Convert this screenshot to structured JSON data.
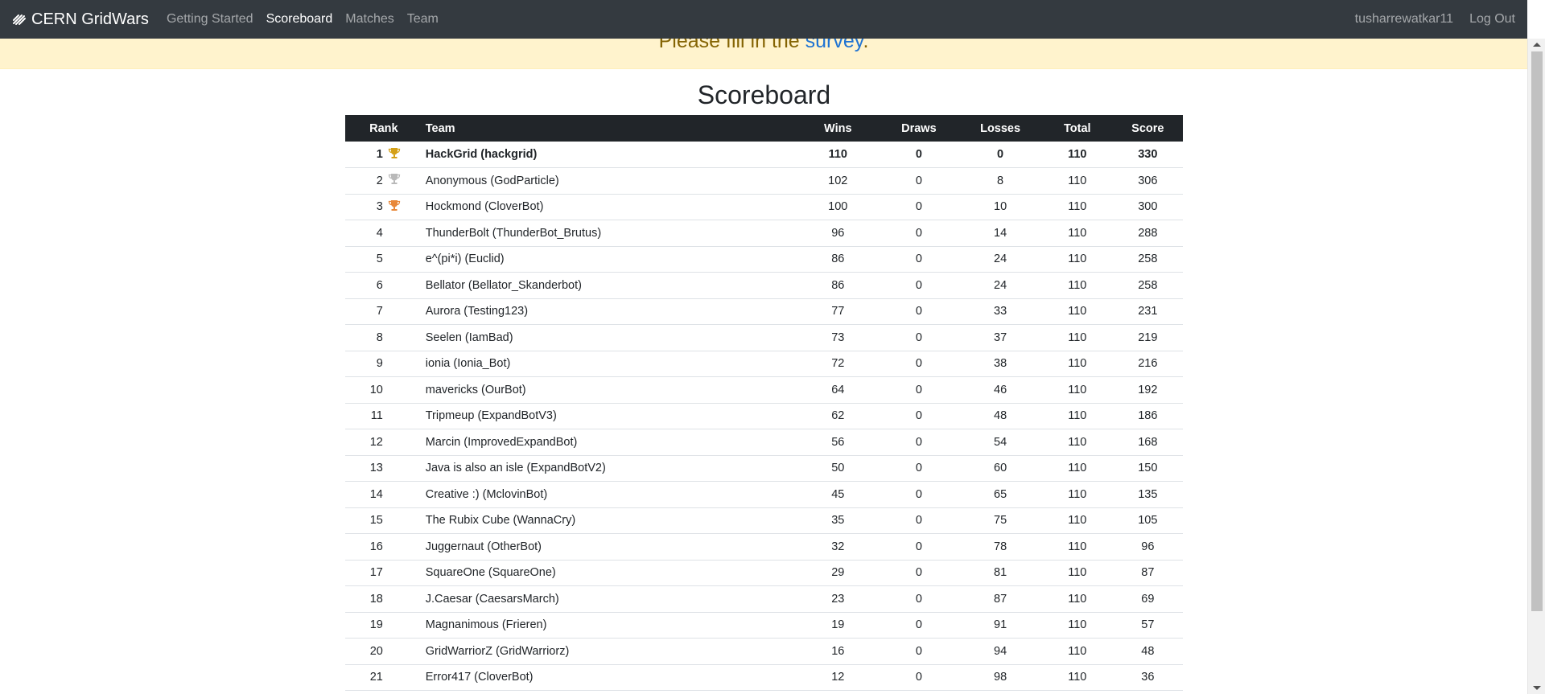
{
  "navbar": {
    "brand": "CERN GridWars",
    "links": [
      "Getting Started",
      "Scoreboard",
      "Matches",
      "Team"
    ],
    "user": "tusharrewatkar11",
    "logout": "Log Out"
  },
  "alert": {
    "prefix": "Please fill in the ",
    "link": "survey",
    "suffix": "."
  },
  "page_title": "Scoreboard",
  "table": {
    "headers": [
      "Rank",
      "Team",
      "Wins",
      "Draws",
      "Losses",
      "Total",
      "Score"
    ],
    "trophy_colors": {
      "gold": "#d4a017",
      "silver": "#b9b9b9",
      "bronze": "#e8883a"
    },
    "rows": [
      {
        "rank": "1",
        "team": "HackGrid (hackgrid)",
        "wins": "110",
        "draws": "0",
        "losses": "0",
        "total": "110",
        "score": "330"
      },
      {
        "rank": "2",
        "team": "Anonymous (GodParticle)",
        "wins": "102",
        "draws": "0",
        "losses": "8",
        "total": "110",
        "score": "306"
      },
      {
        "rank": "3",
        "team": "Hockmond (CloverBot)",
        "wins": "100",
        "draws": "0",
        "losses": "10",
        "total": "110",
        "score": "300"
      },
      {
        "rank": "4",
        "team": "ThunderBolt (ThunderBot_Brutus)",
        "wins": "96",
        "draws": "0",
        "losses": "14",
        "total": "110",
        "score": "288"
      },
      {
        "rank": "5",
        "team": "e^(pi*i) (Euclid)",
        "wins": "86",
        "draws": "0",
        "losses": "24",
        "total": "110",
        "score": "258"
      },
      {
        "rank": "6",
        "team": "Bellator (Bellator_Skanderbot)",
        "wins": "86",
        "draws": "0",
        "losses": "24",
        "total": "110",
        "score": "258"
      },
      {
        "rank": "7",
        "team": "Aurora (Testing123)",
        "wins": "77",
        "draws": "0",
        "losses": "33",
        "total": "110",
        "score": "231"
      },
      {
        "rank": "8",
        "team": "Seelen (IamBad)",
        "wins": "73",
        "draws": "0",
        "losses": "37",
        "total": "110",
        "score": "219"
      },
      {
        "rank": "9",
        "team": "ionia (Ionia_Bot)",
        "wins": "72",
        "draws": "0",
        "losses": "38",
        "total": "110",
        "score": "216"
      },
      {
        "rank": "10",
        "team": "mavericks (OurBot)",
        "wins": "64",
        "draws": "0",
        "losses": "46",
        "total": "110",
        "score": "192"
      },
      {
        "rank": "11",
        "team": "Tripmeup (ExpandBotV3)",
        "wins": "62",
        "draws": "0",
        "losses": "48",
        "total": "110",
        "score": "186"
      },
      {
        "rank": "12",
        "team": "Marcin (ImprovedExpandBot)",
        "wins": "56",
        "draws": "0",
        "losses": "54",
        "total": "110",
        "score": "168"
      },
      {
        "rank": "13",
        "team": "Java is also an isle (ExpandBotV2)",
        "wins": "50",
        "draws": "0",
        "losses": "60",
        "total": "110",
        "score": "150"
      },
      {
        "rank": "14",
        "team": "Creative :) (MclovinBot)",
        "wins": "45",
        "draws": "0",
        "losses": "65",
        "total": "110",
        "score": "135"
      },
      {
        "rank": "15",
        "team": "The Rubix Cube (WannaCry)",
        "wins": "35",
        "draws": "0",
        "losses": "75",
        "total": "110",
        "score": "105"
      },
      {
        "rank": "16",
        "team": "Juggernaut (OtherBot)",
        "wins": "32",
        "draws": "0",
        "losses": "78",
        "total": "110",
        "score": "96"
      },
      {
        "rank": "17",
        "team": "SquareOne (SquareOne)",
        "wins": "29",
        "draws": "0",
        "losses": "81",
        "total": "110",
        "score": "87"
      },
      {
        "rank": "18",
        "team": "J.Caesar (CaesarsMarch)",
        "wins": "23",
        "draws": "0",
        "losses": "87",
        "total": "110",
        "score": "69"
      },
      {
        "rank": "19",
        "team": "Magnanimous (Frieren)",
        "wins": "19",
        "draws": "0",
        "losses": "91",
        "total": "110",
        "score": "57"
      },
      {
        "rank": "20",
        "team": "GridWarriorZ (GridWarriorz)",
        "wins": "16",
        "draws": "0",
        "losses": "94",
        "total": "110",
        "score": "48"
      },
      {
        "rank": "21",
        "team": "Error417 (CloverBot)",
        "wins": "12",
        "draws": "0",
        "losses": "98",
        "total": "110",
        "score": "36"
      }
    ]
  }
}
